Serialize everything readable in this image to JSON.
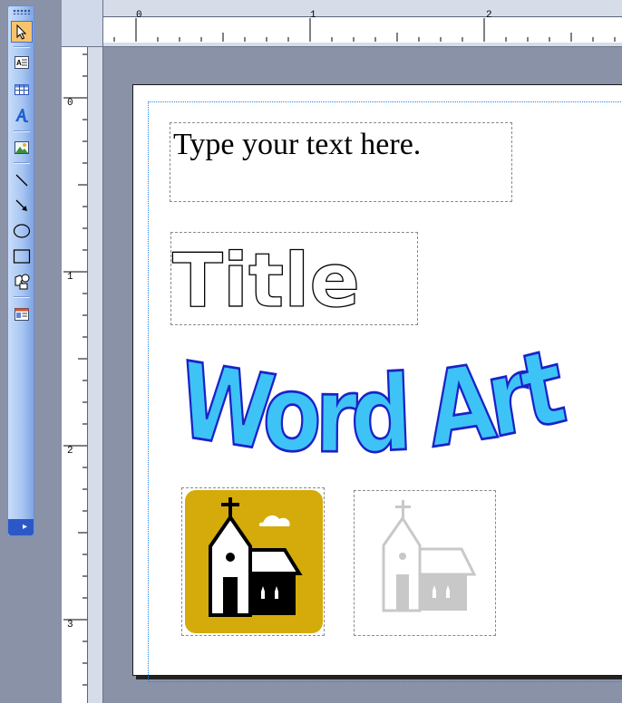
{
  "toolbar": {
    "tools": [
      {
        "name": "select-objects",
        "active": true
      },
      {
        "name": "text-box"
      },
      {
        "name": "insert-table"
      },
      {
        "name": "insert-wordart"
      },
      {
        "name": "picture-frame"
      },
      {
        "name": "line"
      },
      {
        "name": "arrow"
      },
      {
        "name": "oval"
      },
      {
        "name": "rectangle"
      },
      {
        "name": "autoshapes"
      },
      {
        "name": "design-gallery-object"
      }
    ],
    "more_label": "▸"
  },
  "rulers": {
    "horizontal_labels": [
      "0",
      "1",
      "2"
    ],
    "vertical_labels": [
      "0",
      "1",
      "2",
      "3"
    ]
  },
  "page": {
    "textbox_text": "Type your text here.",
    "title_text": "Title",
    "wordart_text": "Word Art"
  },
  "colors": {
    "wordart_fill": "#3ec3f6",
    "wordart_stroke": "#1a22c8",
    "clipart_bg": "#d4ab0a",
    "margin_guide": "#1e86e6"
  }
}
